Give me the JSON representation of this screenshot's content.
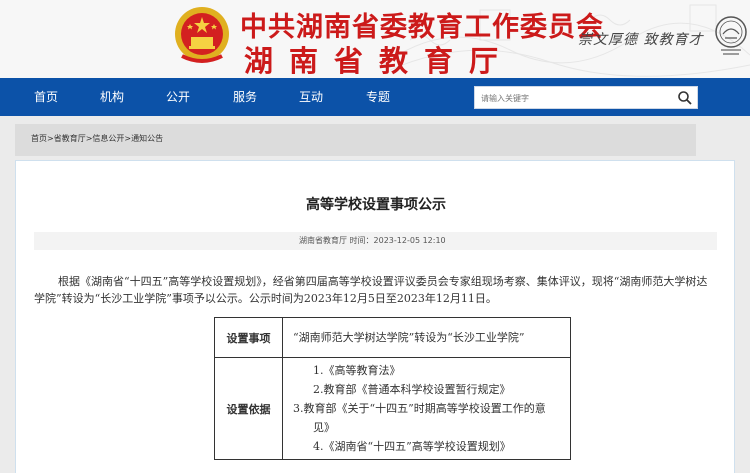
{
  "header": {
    "title": "中共湖南省委教育工作委员会",
    "subtitle": "湖南省教育厅",
    "slogan": "崇文厚德 致教育才"
  },
  "nav": {
    "items": [
      "首页",
      "机构",
      "公开",
      "服务",
      "互动",
      "专题"
    ],
    "search_placeholder": "请输入关键字",
    "bg_color": "#0c52a8"
  },
  "breadcrumb": {
    "text": "首页>省教育厅>信息公开>通知公告"
  },
  "article": {
    "title": "高等学校设置事项公示",
    "meta": "湖南省教育厅  时间：2023-12-05 12:10",
    "body": "根据《湖南省“十四五”高等学校设置规划》，经省第四届高等学校设置评议委员会专家组现场考察、集体评议，现将“湖南师范大学树达学院”转设为“长沙工业学院”事项予以公示。公示时间为2023年12月5日至2023年12月11日。",
    "table": {
      "row1_head": "设置事项",
      "row1_value": "“湖南师范大学树达学院”转设为“长沙工业学院”",
      "row2_head": "设置依据",
      "basis": [
        "1.《高等教育法》",
        "2.教育部《普通本科学校设置暂行规定》",
        "3.教育部《关于“十四五”时期高等学校设置工作的意见》",
        "4.《湖南省“十四五”高等学校设置规划》"
      ]
    }
  }
}
